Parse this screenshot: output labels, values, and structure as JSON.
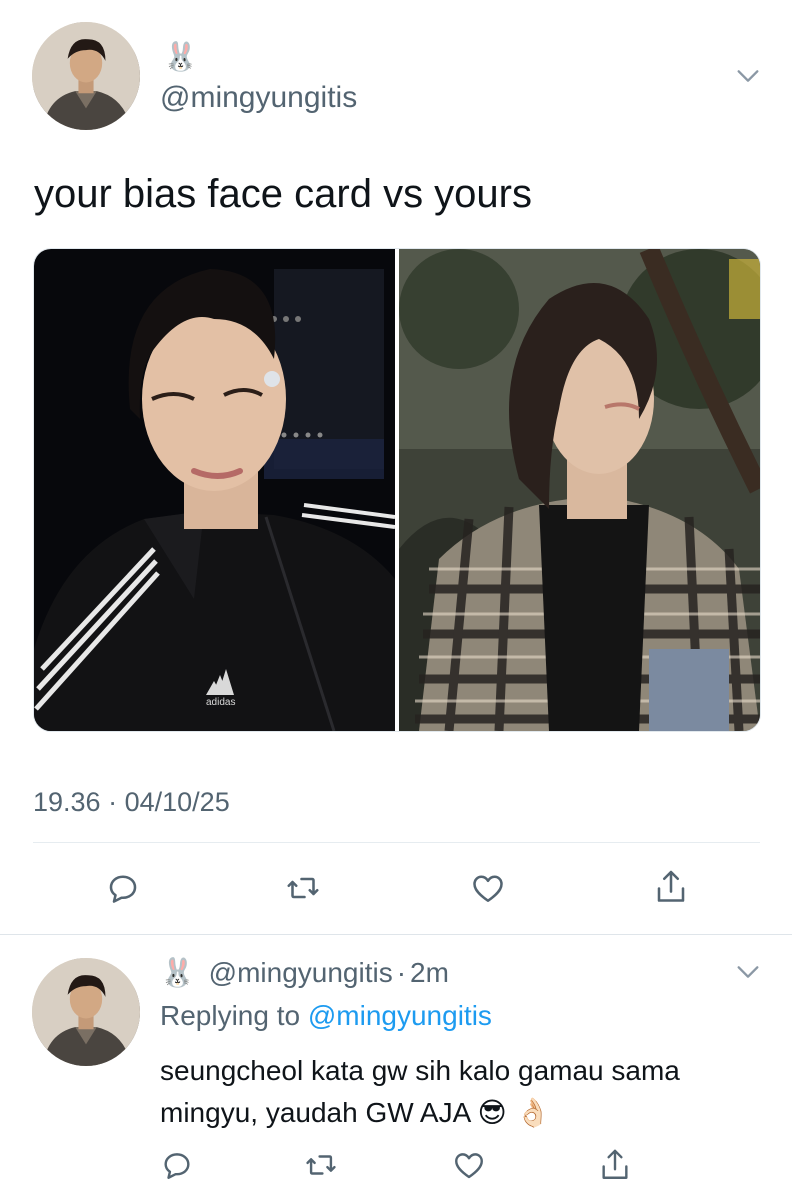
{
  "tweet": {
    "user_emoji": "🐰",
    "handle": "@mingyungitis",
    "text": "your bias face card vs yours",
    "media": [
      {
        "alt": "photo-1",
        "brand_text": "adidas"
      },
      {
        "alt": "photo-2"
      }
    ],
    "time": "19.36",
    "separator": "·",
    "date": "04/10/25"
  },
  "reply": {
    "user_emoji": "🐰",
    "handle": "@mingyungitis",
    "separator": "·",
    "age": "2m",
    "replying_prefix": "Replying to",
    "replying_handle": "@mingyungitis",
    "text_line1": "seungcheol kata gw sih kalo gamau sama",
    "text_line2": "mingyu, yaudah GW AJA",
    "text_emojis": "😎 👌🏻"
  },
  "icons": {
    "reply": "reply-icon",
    "retweet": "retweet-icon",
    "like": "heart-icon",
    "share": "share-icon",
    "menu": "chevron-down-icon"
  },
  "colors": {
    "text": "#0f1419",
    "secondary": "#536471",
    "link": "#1d9bf0",
    "divider": "#e6ecf0"
  }
}
